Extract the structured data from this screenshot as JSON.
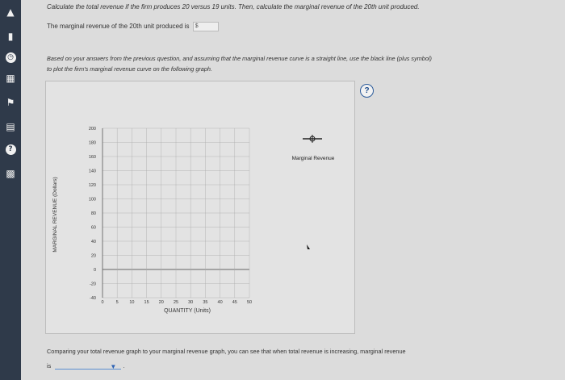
{
  "sidebar": {
    "icons": [
      "home-icon",
      "book-icon",
      "clock-icon",
      "grid-icon",
      "flag-icon",
      "calculator-icon",
      "help-icon",
      "video-icon"
    ]
  },
  "question": {
    "prompt": "Calculate the total revenue if the firm produces 20 versus 19 units. Then, calculate the marginal revenue of the 20th unit produced.",
    "mr_label": "The marginal revenue of the 20th unit produced is",
    "mr_unit": "$",
    "mr_value": ""
  },
  "instructions": {
    "line1": "Based on your answers from the previous question, and assuming that the marginal revenue curve is a straight line, use the black line (plus symbol)",
    "line2": "to plot the firm's marginal revenue curve on the following graph."
  },
  "graph": {
    "help_label": "?",
    "legend_label": "Marginal Revenue"
  },
  "chart_data": {
    "type": "line",
    "xlabel": "QUANTITY (Units)",
    "ylabel": "MARGINAL REVENUE (Dollars)",
    "xlim": [
      0,
      50
    ],
    "ylim": [
      -40,
      200
    ],
    "x_ticks": [
      "0",
      "5",
      "10",
      "15",
      "20",
      "25",
      "30",
      "35",
      "40",
      "45",
      "50"
    ],
    "y_ticks": [
      "200",
      "180",
      "160",
      "140",
      "120",
      "100",
      "80",
      "60",
      "40",
      "20",
      "0",
      "-20",
      "-40"
    ],
    "grid": true,
    "series": []
  },
  "bottom": {
    "comparison": "Comparing your total revenue graph to your marginal revenue graph, you can see that when total revenue is increasing, marginal revenue",
    "is_label": "is",
    "dropdown_value": ""
  }
}
